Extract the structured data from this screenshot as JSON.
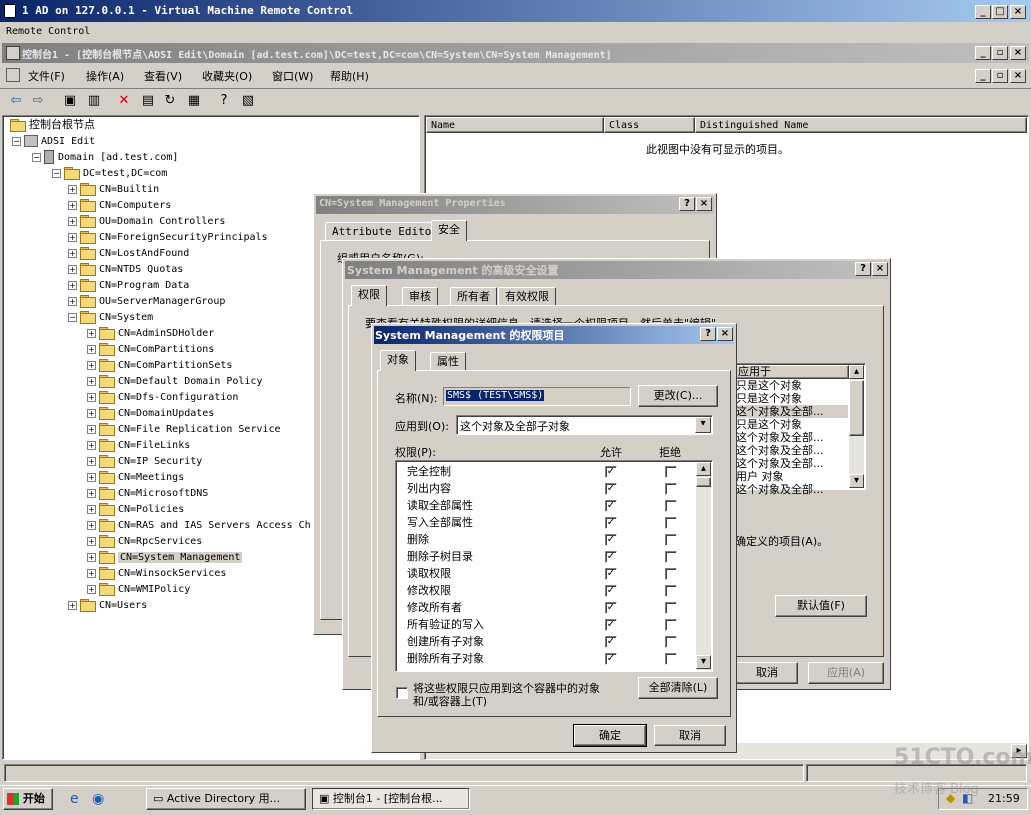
{
  "vm_window": {
    "title": "1 AD on 127.0.0.1 - Virtual Machine Remote Control",
    "menu": "Remote Control"
  },
  "console": {
    "title": "控制台1 - [控制台根节点\\ADSI Edit\\Domain [ad.test.com]\\DC=test,DC=com\\CN=System\\CN=System Management]",
    "menu": [
      "文件(F)",
      "操作(A)",
      "查看(V)",
      "收藏夹(O)",
      "窗口(W)",
      "帮助(H)"
    ]
  },
  "tree": {
    "root": "控制台根节点",
    "adsi": "ADSI Edit",
    "domain": "Domain [ad.test.com]",
    "dc": "DC=test,DC=com",
    "level1": [
      "CN=Builtin",
      "CN=Computers",
      "OU=Domain Controllers",
      "CN=ForeignSecurityPrincipals",
      "CN=LostAndFound",
      "CN=NTDS Quotas",
      "CN=Program Data",
      "OU=ServerManagerGroup",
      "CN=System"
    ],
    "system_children": [
      "CN=AdminSDHolder",
      "CN=ComPartitions",
      "CN=ComPartitionSets",
      "CN=Default Domain Policy",
      "CN=Dfs-Configuration",
      "CN=DomainUpdates",
      "CN=File Replication Service",
      "CN=FileLinks",
      "CN=IP Security",
      "CN=Meetings",
      "CN=MicrosoftDNS",
      "CN=Policies",
      "CN=RAS and IAS Servers Access Ch",
      "CN=RpcServices",
      "CN=System Management",
      "CN=WinsockServices",
      "CN=WMIPolicy"
    ],
    "users": "CN=Users"
  },
  "list": {
    "columns": [
      "Name",
      "Class",
      "Distinguished Name"
    ],
    "empty_message": "此视图中没有可显示的项目。"
  },
  "props_dialog": {
    "title": "CN=System Management Properties",
    "tabs": [
      "Attribute Editor",
      "安全"
    ],
    "partial_label": "组或用户名称(G):"
  },
  "adv_dialog": {
    "title": "System Management 的高级安全设置",
    "tabs": [
      "权限",
      "审核",
      "所有者",
      "有效权限"
    ],
    "intro": "要查看有关特殊权限的详细信息，请选择一个权限项目，然后单击\"编辑\"。",
    "apply_header": "应用于",
    "apply_rows": [
      "只是这个对象",
      "只是这个对象",
      "这个对象及全部...",
      "只是这个对象",
      "这个对象及全部...",
      "这个对象及全部...",
      "这个对象及全部...",
      "用户 对象",
      "这个对象及全部..."
    ],
    "defined_text": "确定义的项目(A)。",
    "default_btn": "默认值(F)",
    "cancel_btn": "取消",
    "apply_btn": "应用(A)"
  },
  "perm_dialog": {
    "title": "System Management 的权限项目",
    "tabs": [
      "对象",
      "属性"
    ],
    "name_label": "名称(N):",
    "name_value": "SMS$ (TEST\\SMS$)",
    "change_btn": "更改(C)...",
    "apply_label": "应用到(O):",
    "apply_value": "这个对象及全部子对象",
    "perm_label": "权限(P):",
    "allow_header": "允许",
    "deny_header": "拒绝",
    "permissions": [
      {
        "name": "完全控制",
        "allow": true,
        "deny": false
      },
      {
        "name": "列出内容",
        "allow": true,
        "deny": false
      },
      {
        "name": "读取全部属性",
        "allow": true,
        "deny": false
      },
      {
        "name": "写入全部属性",
        "allow": true,
        "deny": false
      },
      {
        "name": "删除",
        "allow": true,
        "deny": false
      },
      {
        "name": "删除子树目录",
        "allow": true,
        "deny": false
      },
      {
        "name": "读取权限",
        "allow": true,
        "deny": false
      },
      {
        "name": "修改权限",
        "allow": true,
        "deny": false
      },
      {
        "name": "修改所有者",
        "allow": true,
        "deny": false
      },
      {
        "name": "所有验证的写入",
        "allow": true,
        "deny": false
      },
      {
        "name": "创建所有子对象",
        "allow": true,
        "deny": false
      },
      {
        "name": "删除所有子对象",
        "allow": true,
        "deny": false
      }
    ],
    "container_only": "将这些权限只应用到这个容器中的对象\n和/或容器上(T)",
    "container_line1": "将这些权限只应用到这个容器中的对象",
    "container_line2": "和/或容器上(T)",
    "clear_btn": "全部清除(L)",
    "ok_btn": "确定",
    "cancel_btn": "取消"
  },
  "taskbar": {
    "start": "开始",
    "tasks": [
      "Active Directory 用...",
      "控制台1 - [控制台根..."
    ],
    "clock": "21:59"
  },
  "watermark": {
    "brand": "51CTO.com",
    "sub": "技术博客 Blog"
  }
}
